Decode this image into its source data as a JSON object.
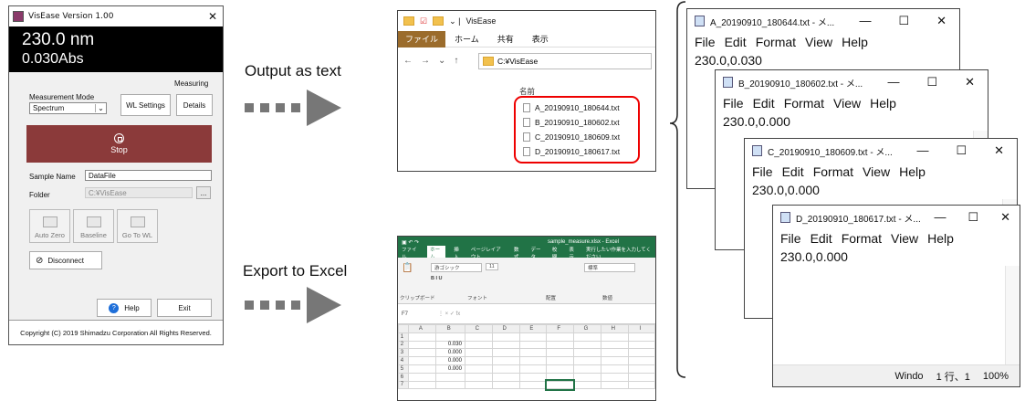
{
  "visease": {
    "title": "VisEase Version 1.00",
    "close": "✕",
    "wavelength": "230.0 nm",
    "absorbance": "0.030Abs",
    "status": "Measuring",
    "measurement_mode_label": "Measurement Mode",
    "mode_value": "Spectrum",
    "wl_settings": "WL Settings",
    "details": "Details",
    "stop": "Stop",
    "sample_name_label": "Sample Name",
    "sample_name_value": "DataFile",
    "folder_label": "Folder",
    "folder_value": "C:¥VisEase",
    "browse": "...",
    "auto_zero": "Auto Zero",
    "baseline": "Baseline",
    "go_to_wl": "Go To WL",
    "disconnect": "Disconnect",
    "help": "Help",
    "exit": "Exit",
    "copyright": "Copyright (C) 2019 Shimadzu Corporation All Rights Reserved.",
    "accent_color": "#8b3a3a"
  },
  "captions": {
    "output_text": "Output as text",
    "export_excel": "Export to Excel"
  },
  "explorer": {
    "title": "VisEase",
    "ribbon": [
      "ファイル",
      "ホーム",
      "共有",
      "表示"
    ],
    "address": "C:¥VisEase",
    "column_name": "名前",
    "files": [
      "A_20190910_180644.txt",
      "B_20190910_180602.txt",
      "C_20190910_180609.txt",
      "D_20190910_180617.txt"
    ]
  },
  "excel": {
    "filename": "sample_measure.xlsx - Excel",
    "tabs": [
      "ファイル",
      "ホーム",
      "挿入",
      "ページレイアウト",
      "数式",
      "データ",
      "校閲",
      "表示"
    ],
    "tell_me": "実行したい作業を入力してください",
    "font_name": "游ゴシック",
    "font_size": "11",
    "number_format": "標準",
    "groups": [
      "クリップボード",
      "フォント",
      "配置",
      "数値"
    ],
    "name_box": "F7",
    "columns": [
      "",
      "A",
      "B",
      "C",
      "D",
      "E",
      "F",
      "G",
      "H",
      "I"
    ],
    "rows": [
      [
        "1",
        "",
        "",
        "",
        "",
        "",
        "",
        "",
        "",
        ""
      ],
      [
        "2",
        "",
        "0.030",
        "",
        "",
        "",
        "",
        "",
        "",
        ""
      ],
      [
        "3",
        "",
        "0.000",
        "",
        "",
        "",
        "",
        "",
        "",
        ""
      ],
      [
        "4",
        "",
        "0.000",
        "",
        "",
        "",
        "",
        "",
        "",
        ""
      ],
      [
        "5",
        "",
        "0.000",
        "",
        "",
        "",
        "",
        "",
        "",
        ""
      ],
      [
        "6",
        "",
        "",
        "",
        "",
        "",
        "",
        "",
        "",
        ""
      ],
      [
        "7",
        "",
        "",
        "",
        "",
        "",
        "",
        "",
        "",
        ""
      ]
    ]
  },
  "notepad": {
    "menu": [
      "File",
      "Edit",
      "Format",
      "View",
      "Help"
    ],
    "windows": [
      {
        "title": "A_20190910_180644.txt - メ...",
        "content": "230.0,0.030"
      },
      {
        "title": "B_20190910_180602.txt - メ...",
        "content": "230.0,0.000"
      },
      {
        "title": "C_20190910_180609.txt - メ...",
        "content": "230.0,0.000"
      },
      {
        "title": "D_20190910_180617.txt - メ...",
        "content": "230.0,0.000"
      }
    ],
    "status": {
      "encoding": "Windo",
      "position": "1 行、1",
      "zoom": "100%"
    }
  }
}
